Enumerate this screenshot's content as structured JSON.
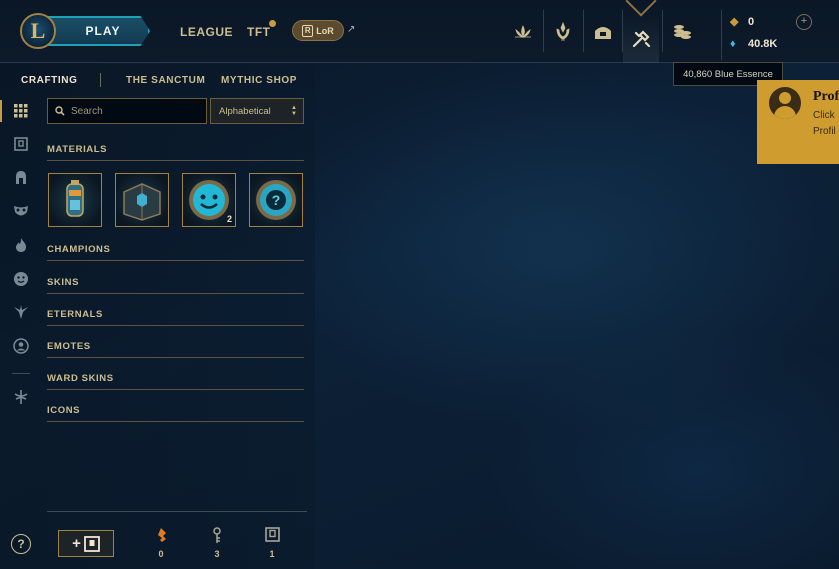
{
  "topbar": {
    "logo_letter": "L",
    "play_label": "PLAY",
    "nav": {
      "league": "LEAGUE",
      "tft": "TFT",
      "lor_label": "LoR",
      "lor_icon_letter": "R"
    },
    "icons": [
      "loot-lotus-icon",
      "missions-icon",
      "collection-icon",
      "crafting-icon",
      "store-coins-icon"
    ],
    "active_icon": "crafting-icon",
    "currency": {
      "rp_value": "0",
      "be_value": "40.8K",
      "add_symbol": "+"
    }
  },
  "tooltip": {
    "text": "40,860 Blue Essence"
  },
  "profile_card": {
    "title": "Prof",
    "line1": "Click",
    "line2": "Profil"
  },
  "subnav": {
    "items": [
      "CRAFTING",
      "THE SANCTUM",
      "MYTHIC SHOP"
    ],
    "active": "CRAFTING"
  },
  "rail": {
    "icons": [
      "grid-icon",
      "chest-icon",
      "champion-helmet-icon",
      "mask-icon",
      "flame-icon",
      "emote-face-icon",
      "ward-icon",
      "profile-icon-icon",
      "eternals-icon"
    ],
    "help_label": "?"
  },
  "search": {
    "placeholder": "Search",
    "value": ""
  },
  "sort": {
    "selected": "Alphabetical"
  },
  "sections": {
    "materials": "MATERIALS",
    "champions": "CHAMPIONS",
    "skins": "SKINS",
    "eternals": "ETERNALS",
    "emotes": "EMOTES",
    "ward_skins": "WARD SKINS",
    "icons": "ICONS"
  },
  "materials": [
    {
      "name": "capsule",
      "count": ""
    },
    {
      "name": "hextech-chest",
      "count": ""
    },
    {
      "name": "emote-orb",
      "count": "2"
    },
    {
      "name": "mystery-orb",
      "count": ""
    }
  ],
  "bottom": {
    "add_chest_plus": "+",
    "resources": [
      {
        "icon": "orange-essence-icon",
        "value": "0",
        "color": "#e07b24"
      },
      {
        "icon": "key-icon",
        "value": "3",
        "color": "#a8a595"
      },
      {
        "icon": "chest-icon",
        "value": "1",
        "color": "#a8a595"
      }
    ]
  },
  "colors": {
    "gold": "#c89b3c",
    "blue_essence": "#47b6e0",
    "tile_border": "#a08245",
    "profile_card": "#cf9c2f"
  }
}
